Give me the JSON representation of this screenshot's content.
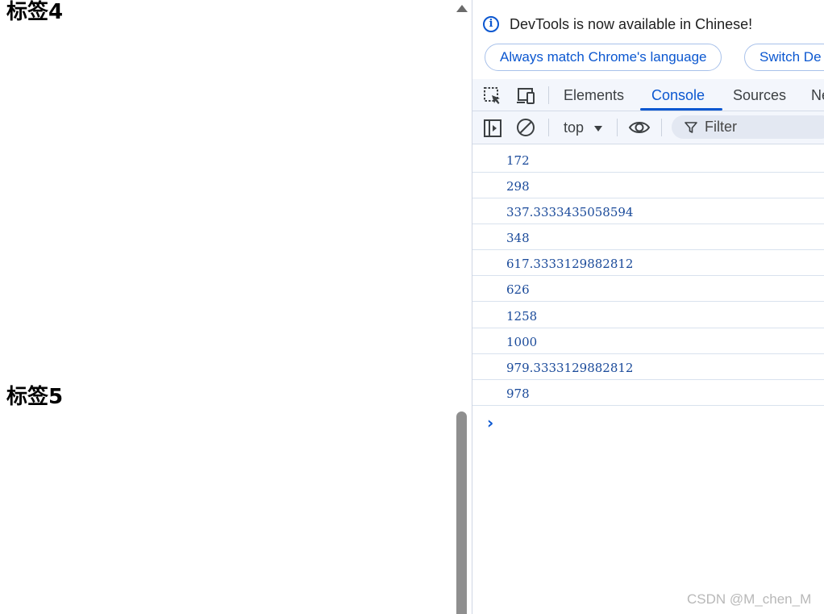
{
  "page": {
    "headings": [
      "标签4",
      "标签5"
    ]
  },
  "devtools": {
    "infobar": {
      "message": "DevTools is now available in Chinese!",
      "info_icon": "info-icon",
      "buttons": [
        "Always match Chrome's language",
        "Switch De"
      ]
    },
    "tabs": [
      {
        "label": "Elements",
        "active": false
      },
      {
        "label": "Console",
        "active": true
      },
      {
        "label": "Sources",
        "active": false
      },
      {
        "label": "Ne",
        "active": false
      }
    ],
    "toolbar": {
      "context": "top",
      "filter_placeholder": "Filter"
    },
    "console_logs": [
      "172",
      "298",
      "337.3333435058594",
      "348",
      "617.3333129882812",
      "626",
      "1258",
      "1000",
      "979.3333129882812",
      "978"
    ],
    "prompt_symbol": "›"
  },
  "watermark": "CSDN @M_chen_M",
  "colors": {
    "accent": "#0b57d0",
    "log_text": "#1a4a9a",
    "toolbar_bg": "#f3f6fc"
  }
}
